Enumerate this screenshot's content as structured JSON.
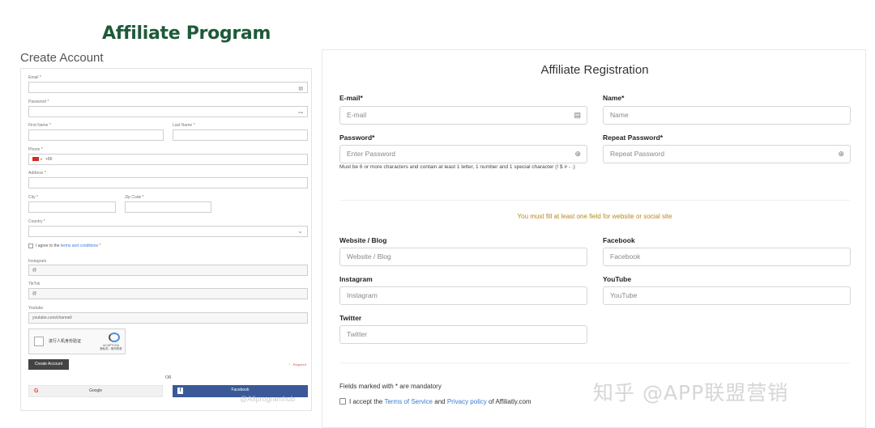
{
  "left": {
    "logo": "Affiliate Program",
    "title": "Create Account",
    "email_label": "Email *",
    "password_label": "Password *",
    "first_name_label": "First Name *",
    "last_name_label": "Last Name *",
    "phone_label": "Phone *",
    "phone_value": "+86",
    "address_label": "Address *",
    "city_label": "City *",
    "zip_label": "Zip Code *",
    "country_label": "Country *",
    "terms_prefix": "I agree to the",
    "terms_link": "terms and conditions",
    "terms_suffix": " *",
    "instagram_label": "Instagram",
    "instagram_prefix": "@",
    "tiktok_label": "TikTok",
    "tiktok_prefix": "@",
    "youtube_label": "Youtube",
    "youtube_prefix": "youtube.com/channel/",
    "captcha_text": "进行人机身份验证",
    "captcha_brand": "reCAPTCHA",
    "captcha_links": "隐私权 - 使用条款",
    "create_button": "Create Account",
    "required_note": "* - Required",
    "or_text": "OR",
    "google_button": "Google",
    "facebook_button": "Facebook",
    "watermark": "@Afiprogramhub"
  },
  "right": {
    "title": "Affiliate Registration",
    "email_label": "E-mail*",
    "email_placeholder": "E-mail",
    "name_label": "Name*",
    "name_placeholder": "Name",
    "password_label": "Password*",
    "password_placeholder": "Enter Password",
    "repeat_label": "Repeat Password*",
    "repeat_placeholder": "Repeat Password",
    "password_hint": "Must be 6 or more characters and contain at least 1 letter, 1 number and 1 special character (! $ # - .)",
    "must_fill": "You must fill at least one field for website or social site",
    "website_label": "Website / Blog",
    "website_placeholder": "Website / Blog",
    "facebook_label": "Facebook",
    "facebook_placeholder": "Facebook",
    "instagram_label": "Instagram",
    "instagram_placeholder": "Instagram",
    "youtube_label": "YouTube",
    "youtube_placeholder": "YouTube",
    "twitter_label": "Twitter",
    "twitter_placeholder": "Twitter",
    "mandatory_note": "Fields marked with * are mandatory",
    "accept_prefix": "I accept the",
    "tos_link": "Terms of Service",
    "and_text": "and",
    "privacy_link": "Privacy policy",
    "accept_suffix": "of Affiliatly.com"
  },
  "watermark": "知乎 @APP联盟营销",
  "colors": {
    "logo": "#1e5a3a",
    "link": "#3a7bd5",
    "warning": "#b58a1c",
    "facebook": "#3b5998"
  }
}
